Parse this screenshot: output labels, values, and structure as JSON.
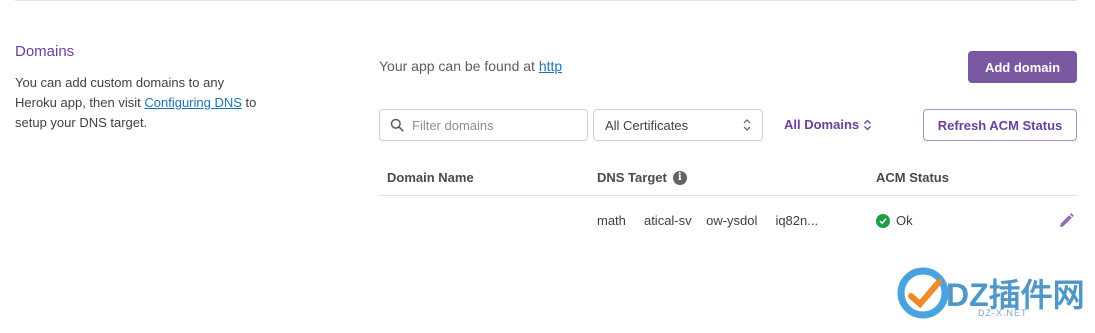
{
  "section": {
    "title": "Domains",
    "desc_pre": "You can add custom domains to any Heroku app, then visit ",
    "desc_link": "Configuring DNS",
    "desc_post": " to setup your DNS target."
  },
  "app_found": {
    "text": "Your app can be found at ",
    "link": "http"
  },
  "add_domain_label": "Add domain",
  "filter": {
    "placeholder": "Filter domains",
    "value": ""
  },
  "certificates_select": {
    "selected": "All Certificates"
  },
  "domains_filter": {
    "label": "All Domains"
  },
  "refresh_label": "Refresh ACM Status",
  "table": {
    "headers": {
      "domain": "Domain Name",
      "dns": "DNS Target",
      "acm": "ACM Status"
    },
    "rows": [
      {
        "domain": "",
        "dns": "math     atical-sv    ow-ysdol     iq82n...",
        "acm": "Ok"
      }
    ]
  },
  "watermark": {
    "text": "DZ插件网",
    "sub": "DZ-X.NET"
  },
  "colors": {
    "accent": "#79589f",
    "link": "#1f72b8",
    "ok": "#1e9d4b"
  },
  "icons": [
    "search-icon",
    "chevron-updown-icon",
    "info-icon",
    "check-icon",
    "edit-icon"
  ]
}
